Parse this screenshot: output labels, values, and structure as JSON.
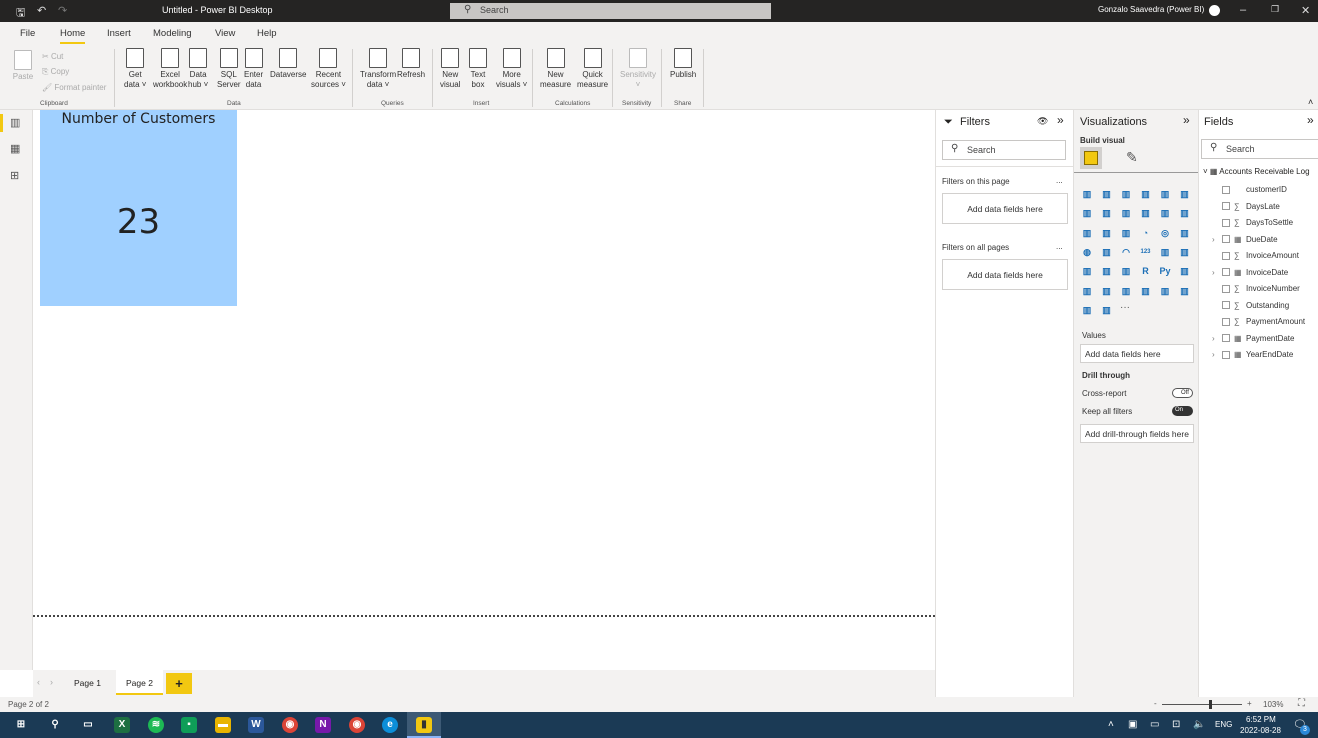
{
  "window": {
    "title": "Untitled - Power BI Desktop",
    "search_placeholder": "Search",
    "user": "Gonzalo Saavedra (Power BI)"
  },
  "menu": [
    "File",
    "Home",
    "Insert",
    "Modeling",
    "View",
    "Help"
  ],
  "menu_active": "Home",
  "ribbon": {
    "clipboard": {
      "paste": "Paste",
      "cut": "Cut",
      "copy": "Copy",
      "format_painter": "Format painter",
      "group": "Clipboard"
    },
    "data": {
      "items": [
        [
          "Get",
          "data ˅"
        ],
        [
          "Excel",
          "workbook"
        ],
        [
          "Data",
          "hub ˅"
        ],
        [
          "SQL",
          "Server"
        ],
        [
          "Enter",
          "data"
        ],
        [
          "Dataverse",
          ""
        ],
        [
          "Recent",
          "sources ˅"
        ]
      ],
      "group": "Data"
    },
    "queries": {
      "items": [
        [
          "Transform",
          "data ˅"
        ],
        [
          "Refresh",
          ""
        ]
      ],
      "group": "Queries"
    },
    "insert": {
      "items": [
        [
          "New",
          "visual"
        ],
        [
          "Text",
          "box"
        ],
        [
          "More",
          "visuals ˅"
        ]
      ],
      "group": "Insert"
    },
    "calculations": {
      "items": [
        [
          "New",
          "measure"
        ],
        [
          "Quick",
          "measure"
        ]
      ],
      "group": "Calculations"
    },
    "sensitivity": {
      "items": [
        [
          "Sensitivity",
          "˅"
        ]
      ],
      "group": "Sensitivity"
    },
    "share": {
      "items": [
        [
          "Publish",
          ""
        ]
      ],
      "group": "Share"
    }
  },
  "card": {
    "title": "Number of Customers",
    "value": "23",
    "color": "#a0d0ff"
  },
  "pages": {
    "tabs": [
      "Page 1",
      "Page 2"
    ],
    "active": "Page 2",
    "add": "+"
  },
  "status": {
    "page": "Page 2 of 2",
    "zoom": "103%",
    "zoom_minus": "-",
    "zoom_plus": "+"
  },
  "filters": {
    "title": "Filters",
    "search": "Search",
    "on_page": "Filters on this page",
    "on_all": "Filters on all pages",
    "add": "Add data fields here",
    "more": "..."
  },
  "visualizations": {
    "title": "Visualizations",
    "build": "Build visual",
    "values": "Values",
    "values_add": "Add data fields here",
    "drill": "Drill through",
    "cross_report": "Cross-report",
    "cross_state": "Off",
    "keep_filters": "Keep all filters",
    "keep_state": "On",
    "drill_add": "Add drill-through fields here",
    "more": "···"
  },
  "fields": {
    "title": "Fields",
    "search": "Search",
    "table": "Accounts Receivable Log",
    "items": [
      {
        "name": "customerID",
        "type": "text"
      },
      {
        "name": "DaysLate",
        "type": "sum"
      },
      {
        "name": "DaysToSettle",
        "type": "sum"
      },
      {
        "name": "DueDate",
        "type": "date"
      },
      {
        "name": "InvoiceAmount",
        "type": "sum"
      },
      {
        "name": "InvoiceDate",
        "type": "date"
      },
      {
        "name": "InvoiceNumber",
        "type": "sum"
      },
      {
        "name": "Outstanding",
        "type": "sum"
      },
      {
        "name": "PaymentAmount",
        "type": "sum"
      },
      {
        "name": "PaymentDate",
        "type": "date"
      },
      {
        "name": "YearEndDate",
        "type": "date"
      }
    ]
  },
  "taskbar": {
    "lang": "ENG",
    "time": "6:52 PM",
    "date": "2022-08-28",
    "notifications": "3"
  }
}
